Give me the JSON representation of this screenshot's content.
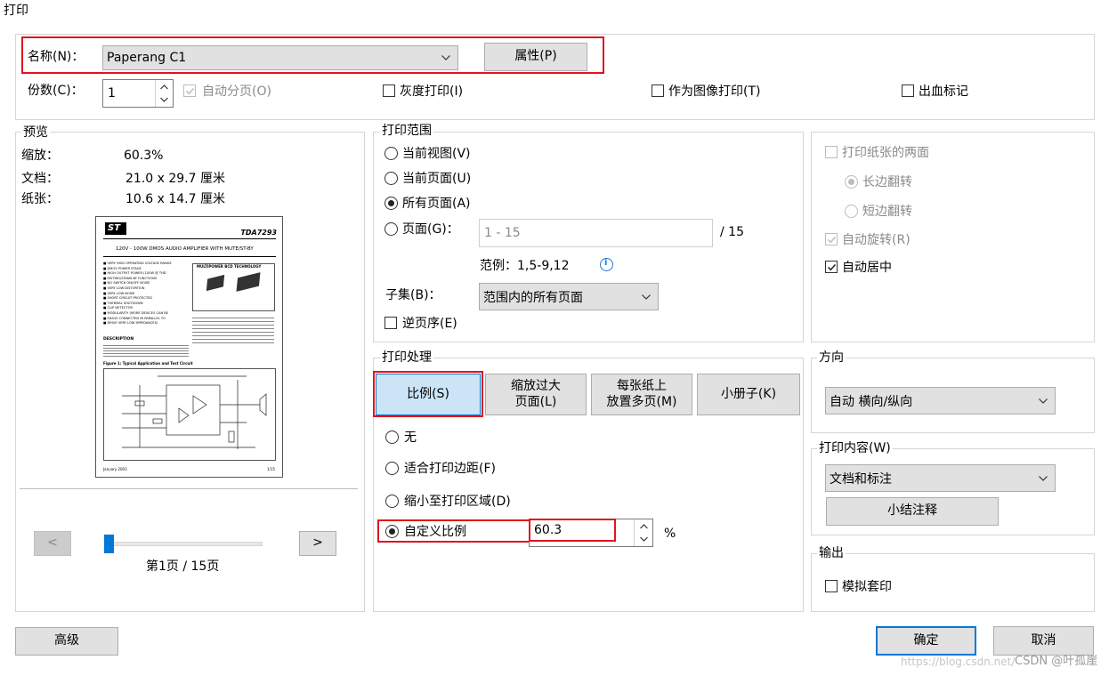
{
  "window": {
    "title": "打印"
  },
  "printer": {
    "name_label": "名称(N)：",
    "name_value": "Paperang C1",
    "properties_button": "属性(P)",
    "copies_label": "份数(C)：",
    "copies_value": "1",
    "collate_label": "自动分页(O)",
    "collate_checked": true,
    "collate_disabled": true,
    "grayscale_label": "灰度打印(I)",
    "as_image_label": "作为图像打印(T)",
    "bleed_label": "出血标记"
  },
  "preview": {
    "legend": "预览",
    "zoom_label": "缩放：",
    "zoom_value": "60.3%",
    "doc_label": "文档：",
    "doc_value": "21.0 x 29.7 厘米",
    "paper_label": "纸张：",
    "paper_value": "10.6 x 14.7 厘米",
    "page_indicator": "第1页 / 15页",
    "prev_label": "<",
    "next_label": ">",
    "slider_position": 0,
    "thumb": {
      "logo": "ST",
      "part": "TDA7293",
      "heading": "120V - 100W DMOS AUDIO AMPLIFIER WITH MUTE/ST-BY",
      "box_title": "MULTIPOWER BCD TECHNOLOGY",
      "features": [
        "VERY HIGH OPERATING VOLTAGE RANGE",
        "DMOS POWER STAGE",
        "HIGH OUTPUT POWER (100W @ THD",
        "MUTING/STAND-BY FUNCTIONS",
        "NO SWITCH ON/OFF NOISE",
        "VERY LOW DISTORTION",
        "VERY LOW NOISE",
        "SHORT CIRCUIT PROTECTED",
        "THERMAL SHUTDOWN",
        "CLIP DETECTOR",
        "MODULARITY (MORE DEVICES CAN BE",
        "EASILY CONNECTED IN PARALLEL TO",
        "DRIVE VERY LOW IMPEDANCES)"
      ],
      "description": "DESCRIPTION",
      "figure_caption": "Figure 1: Typical Application and Test Circuit",
      "footer_left": "January 2003",
      "footer_right": "1/15"
    }
  },
  "range": {
    "legend": "打印范围",
    "current_view": "当前视图(V)",
    "current_page": "当前页面(U)",
    "all_pages": "所有页面(A)",
    "pages_label": "页面(G)：",
    "pages_placeholder": "1 - 15",
    "pages_total": "/ 15",
    "example": "范例：1,5-9,12",
    "subset_label": "子集(B)：",
    "subset_value": "范围内的所有页面",
    "reverse_label": "逆页序(E)",
    "selected": "all_pages"
  },
  "handling": {
    "legend": "打印处理",
    "tabs": [
      {
        "label": "比例(S)",
        "active": true
      },
      {
        "label": "缩放过大\n页面(L)",
        "active": false
      },
      {
        "label": "每张纸上\n放置多页(M)",
        "active": false
      },
      {
        "label": "小册子(K)",
        "active": false
      }
    ],
    "none": "无",
    "fit_margins": "适合打印边距(F)",
    "shrink": "缩小至打印区域(D)",
    "custom": "自定义比例",
    "custom_value": "60.3",
    "percent": "%",
    "selected": "custom"
  },
  "options": {
    "duplex": "打印纸张的两面",
    "long_edge": "长边翻转",
    "short_edge": "短边翻转",
    "auto_rotate": "自动旋转(R)",
    "auto_center": "自动居中",
    "auto_rotate_checked": true,
    "auto_center_checked": true
  },
  "orientation": {
    "legend": "方向",
    "value": "自动 横向/纵向"
  },
  "content": {
    "legend": "打印内容(W)",
    "value": "文档和标注",
    "summary_button": "小结注释"
  },
  "output": {
    "legend": "输出",
    "simulate_label": "模拟套印"
  },
  "footer": {
    "advanced": "高级",
    "ok": "确定",
    "cancel": "取消",
    "watermark": "https://blog.csdn.net/",
    "watermark2": "CSDN @叶孤崖"
  },
  "colors": {
    "highlight": "#e0131f",
    "tab_active_bg": "#cce4f7",
    "button_bg": "#e1e1e1",
    "default_border": "#0078d7"
  }
}
